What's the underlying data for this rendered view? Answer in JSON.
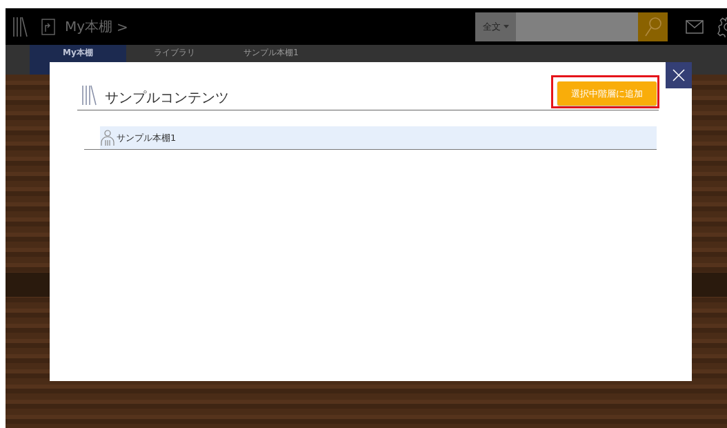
{
  "header": {
    "breadcrumb": "My本棚",
    "breadcrumb_separator": ">",
    "search": {
      "scope": "全文"
    }
  },
  "tabs": [
    {
      "label": "My本棚",
      "selected": true
    },
    {
      "label": "ライブラリ",
      "selected": false
    },
    {
      "label": "サンプル本棚1",
      "selected": false
    }
  ],
  "dialog": {
    "title": "サンプルコンテンツ",
    "add_button": "選択中階層に追加",
    "add_button_highlighted": true,
    "tree": [
      {
        "label": "サンプル本棚1",
        "selected": true
      }
    ]
  }
}
